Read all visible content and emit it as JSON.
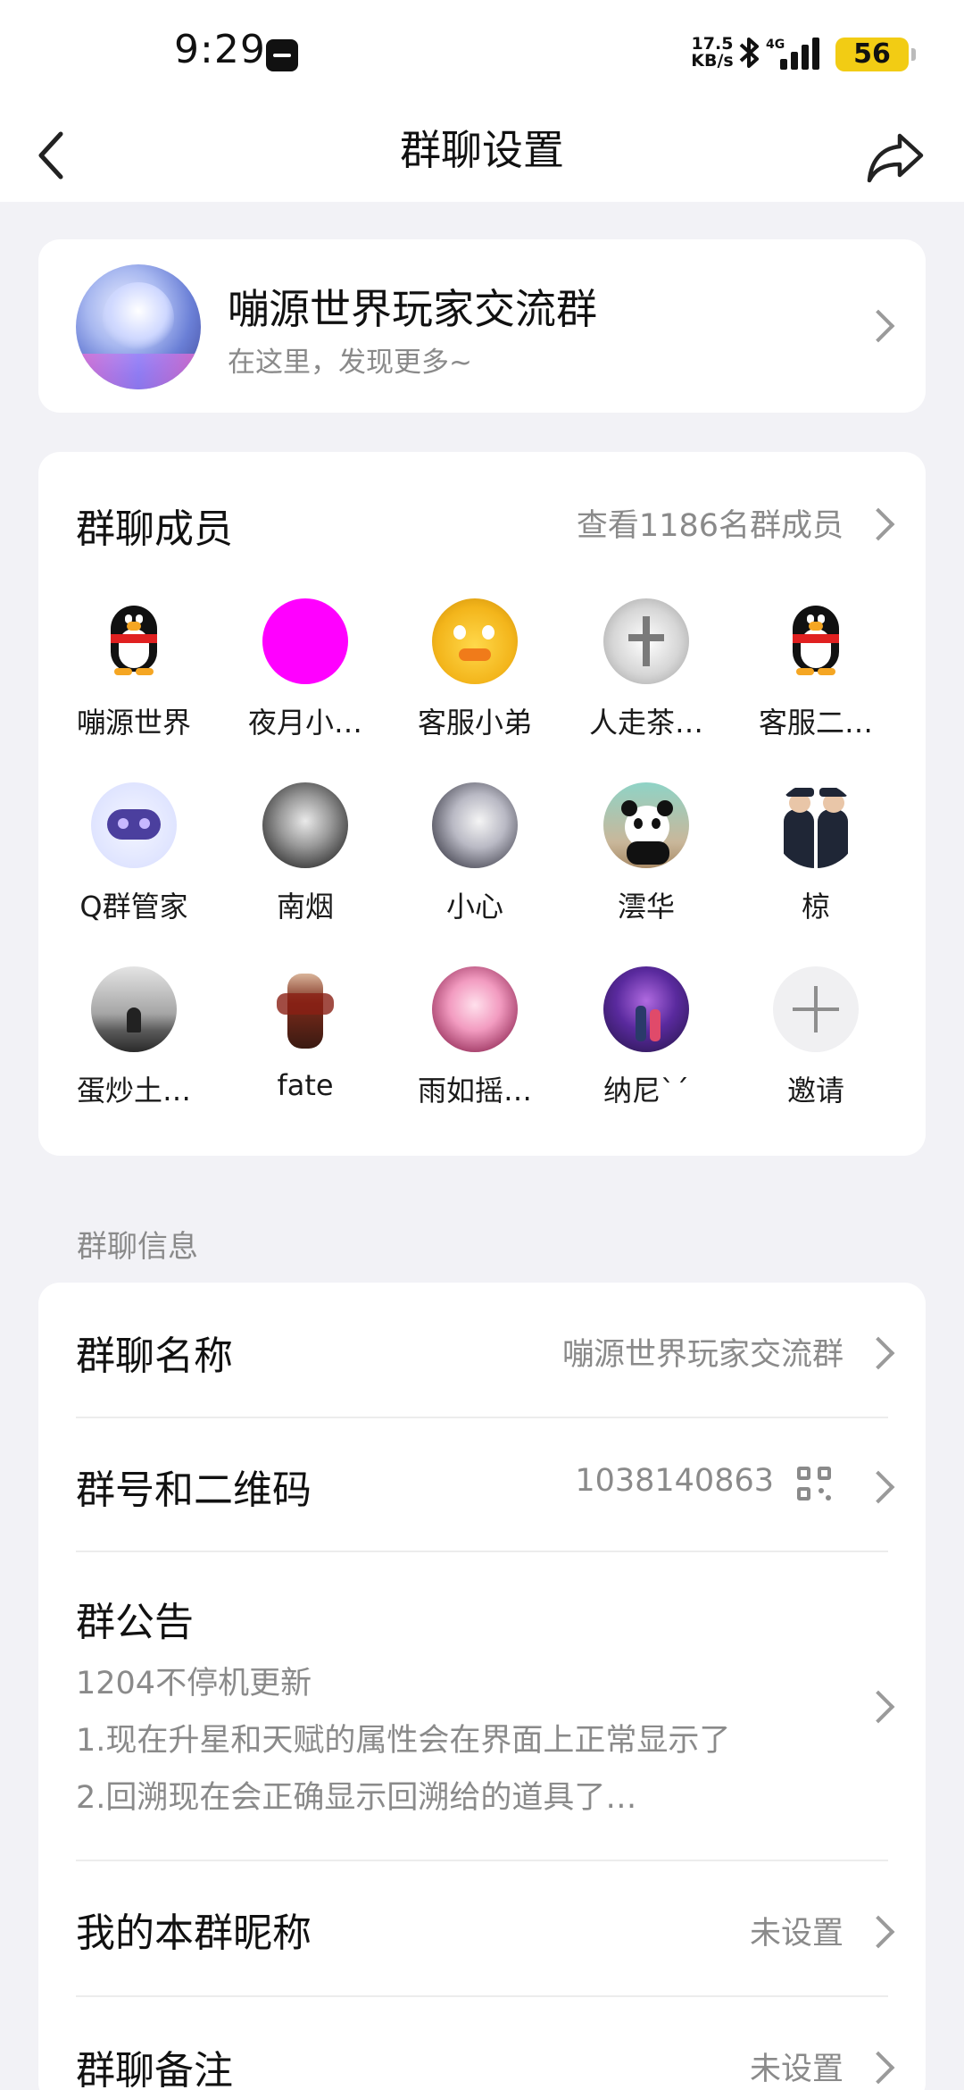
{
  "status_bar": {
    "time": "9:29",
    "network_speed": "17.5\nKB/s",
    "bluetooth_icon": "bluetooth-icon",
    "network_type": "4G",
    "battery": "56",
    "battery_color": "#f2cc14"
  },
  "nav": {
    "title": "群聊设置",
    "back_icon": "back-arrow-icon",
    "share_icon": "share-icon"
  },
  "group": {
    "name": "嘣源世界玩家交流群",
    "subtitle": "在这里，发现更多~"
  },
  "members": {
    "title": "群聊成员",
    "view_all": "查看1186名群成员",
    "items": [
      {
        "name": "嘣源世界",
        "avatar": "penguin"
      },
      {
        "name": "夜月小…",
        "avatar": "magenta",
        "color": "#ff00ff"
      },
      {
        "name": "客服小弟",
        "avatar": "yellow-character"
      },
      {
        "name": "人走茶…",
        "avatar": "silver-cross"
      },
      {
        "name": "客服二…",
        "avatar": "penguin"
      },
      {
        "name": "Q群管家",
        "avatar": "robot"
      },
      {
        "name": "南烟",
        "avatar": "bw-portrait"
      },
      {
        "name": "小心",
        "avatar": "anime-girl"
      },
      {
        "name": "澐华",
        "avatar": "panda"
      },
      {
        "name": "椋",
        "avatar": "police"
      },
      {
        "name": "蛋炒土…",
        "avatar": "silhouette"
      },
      {
        "name": "fate",
        "avatar": "warrior"
      },
      {
        "name": "雨如摇…",
        "avatar": "pink-anime"
      },
      {
        "name": "纳尼ˋˊ",
        "avatar": "night-scene"
      },
      {
        "name": "邀请",
        "avatar": "invite-plus"
      }
    ]
  },
  "info_section": {
    "label": "群聊信息",
    "group_name_label": "群聊名称",
    "group_name_value": "嘣源世界玩家交流群",
    "group_id_label": "群号和二维码",
    "group_id_value": "1038140863",
    "qr_icon": "qr-code-icon",
    "notice_label": "群公告",
    "notice_lines": [
      "1204不停机更新",
      "1.现在升星和天赋的属性会在界面上正常显示了",
      "2.回溯现在会正确显示回溯给的道具了…"
    ],
    "nickname_label": "我的本群昵称",
    "nickname_value": "未设置",
    "remark_label": "群聊备注",
    "remark_value": "未设置"
  }
}
